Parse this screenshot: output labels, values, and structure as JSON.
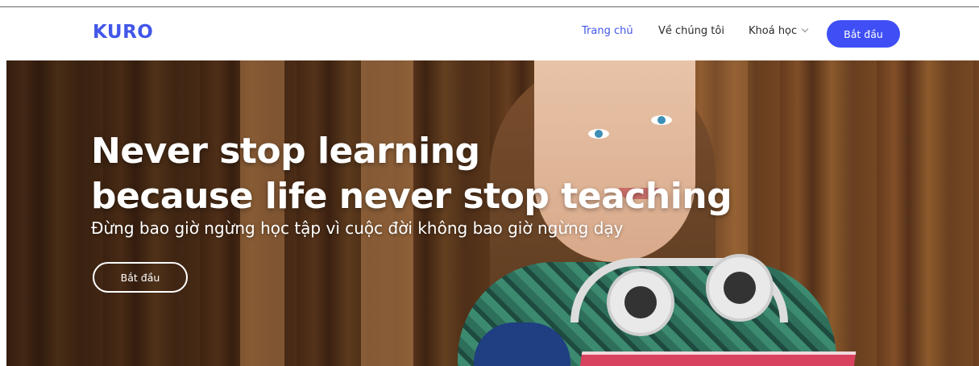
{
  "header": {
    "logo": "KURO",
    "nav": [
      {
        "label": "Trang chủ",
        "active": true
      },
      {
        "label": "Về chúng tôi",
        "active": false
      },
      {
        "label": "Khoá học",
        "active": false
      }
    ],
    "cta_label": "Bắt đầu"
  },
  "hero": {
    "title_line1": "Never stop learning",
    "title_line2": "because life never stop teaching",
    "subtitle": "Đừng bao giờ ngừng học tập vì cuộc đời không bao giờ ngừng dạy",
    "button_label": "Bắt đầu"
  },
  "colors": {
    "brand": "#4257e8",
    "cta": "#3f4ff5"
  }
}
